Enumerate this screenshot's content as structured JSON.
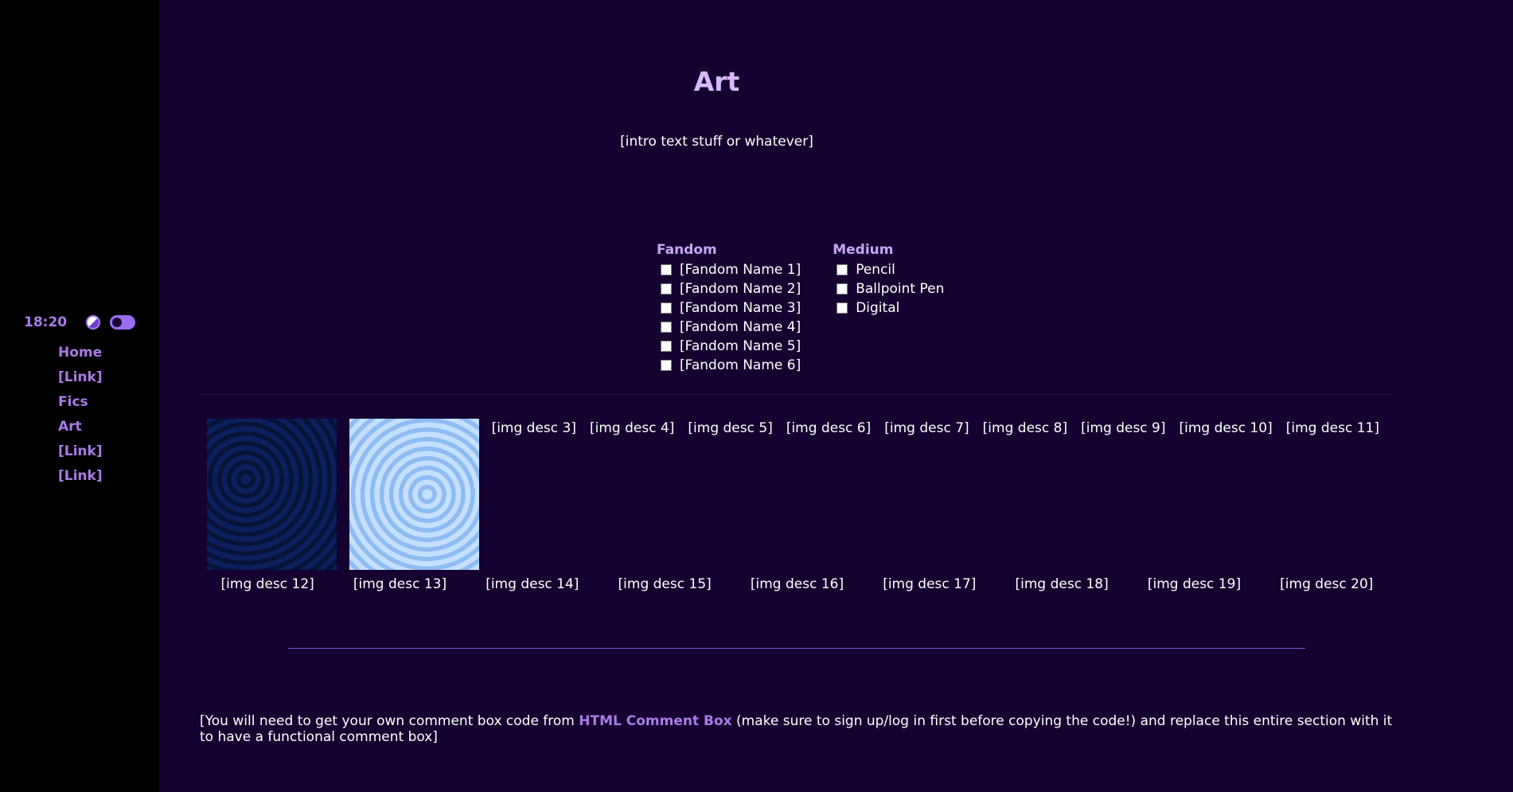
{
  "sidebar": {
    "clock": "18:20",
    "contrast_icon": "half-circle-contrast-icon",
    "toggle_icon": "toggle-switch-icon",
    "nav": [
      "Home",
      "[Link]",
      "Fics",
      "Art",
      "[Link]",
      "[Link]"
    ]
  },
  "main": {
    "title": "Art",
    "intro": "[intro text stuff or whatever]",
    "filters": {
      "fandom": {
        "heading": "Fandom",
        "items": [
          "[Fandom Name 1]",
          "[Fandom Name 2]",
          "[Fandom Name 3]",
          "[Fandom Name 4]",
          "[Fandom Name 5]",
          "[Fandom Name 6]"
        ]
      },
      "medium": {
        "heading": "Medium",
        "items": [
          "Pencil",
          "Ballpoint Pen",
          "Digital"
        ]
      }
    },
    "gallery": {
      "row1_descs": [
        "[img desc 3]",
        "[img desc 4]",
        "[img desc 5]",
        "[img desc 6]",
        "[img desc 7]",
        "[img desc 8]",
        "[img desc 9]",
        "[img desc 10]",
        "[img desc 11]"
      ],
      "row2_descs": [
        "[img desc 12]",
        "[img desc 13]",
        "[img desc 14]",
        "[img desc 15]",
        "[img desc 16]",
        "[img desc 17]",
        "[img desc 18]",
        "[img desc 19]",
        "[img desc 20]"
      ]
    },
    "comment": {
      "before": "[You will need to get your own comment box code from ",
      "link": "HTML Comment Box",
      "after": " (make sure to sign up/log in first before copying the code!) and replace this entire section with it to have a functional comment box]"
    }
  },
  "colors": {
    "background": "#150230",
    "sidebar": "#000000",
    "accent": "#a97be6",
    "heading": "#d7b9ff"
  }
}
